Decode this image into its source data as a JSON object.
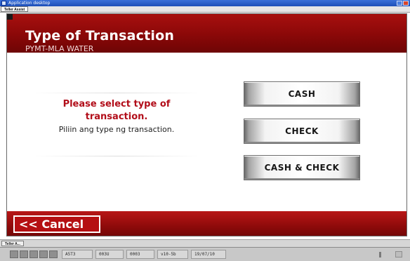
{
  "window": {
    "title": "Application desktop"
  },
  "menubar": {
    "tab_label": "Teller Assist"
  },
  "screen": {
    "title": "Type of Transaction",
    "subtitle": "PYMT-MLA WATER",
    "prompt_main": "Please select type of transaction.",
    "prompt_sub": "Piliin ang type ng transaction."
  },
  "buttons": {
    "cash": "CASH",
    "check": "CHECK",
    "cash_and_check": "CASH & CHECK",
    "cancel": "<< Cancel"
  },
  "taskbar": {
    "item_label": "Teller A..."
  },
  "statusbar": {
    "cells": [
      "A5T3",
      "003U",
      "0003",
      "v10-5b",
      "19/07/10"
    ]
  },
  "colors": {
    "header_red": "#8a0808",
    "prompt_red": "#b20e1a"
  }
}
